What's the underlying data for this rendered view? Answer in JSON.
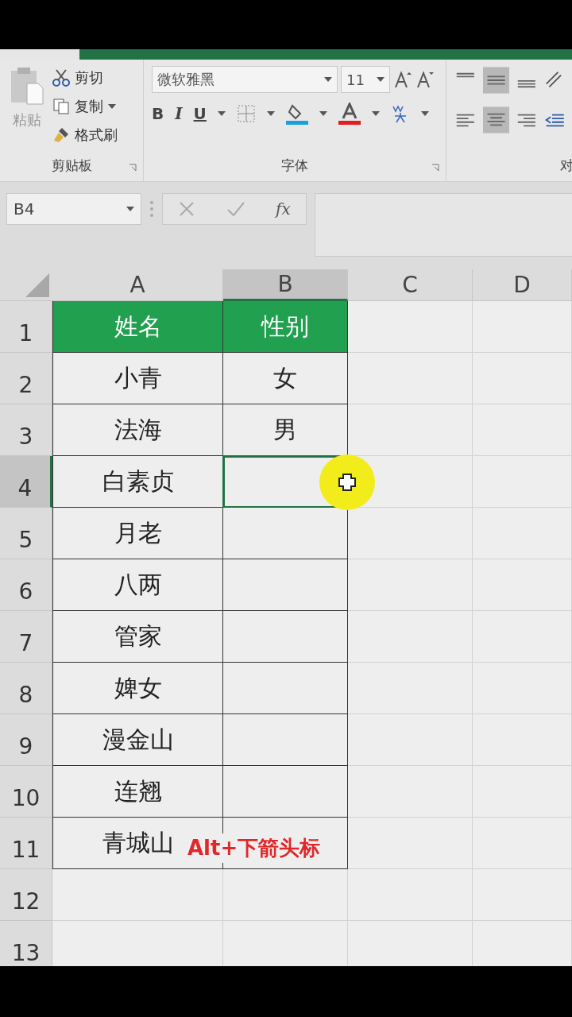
{
  "ribbon": {
    "clipboard": {
      "label": "剪贴板",
      "paste": "粘贴",
      "cut": "剪切",
      "copy": "复制",
      "format_painter": "格式刷"
    },
    "font": {
      "label": "字体",
      "font_name": "微软雅黑",
      "font_size": "11",
      "bold": "B",
      "italic": "I",
      "underline": "U"
    },
    "alignment": {
      "label": "对"
    }
  },
  "formula_bar": {
    "name_box": "B4",
    "fx": "fx"
  },
  "columns": [
    {
      "label": "A",
      "selected": false
    },
    {
      "label": "B",
      "selected": true
    },
    {
      "label": "C",
      "selected": false
    },
    {
      "label": "D",
      "selected": false
    }
  ],
  "rows": [
    {
      "label": "1",
      "kind": "header",
      "selected": false,
      "cells": [
        "姓名",
        "性别"
      ]
    },
    {
      "label": "2",
      "kind": "data",
      "selected": false,
      "cells": [
        "小青",
        "女"
      ]
    },
    {
      "label": "3",
      "kind": "data",
      "selected": false,
      "cells": [
        "法海",
        "男"
      ]
    },
    {
      "label": "4",
      "kind": "data",
      "selected": true,
      "cells": [
        "白素贞"
      ]
    },
    {
      "label": "5",
      "kind": "data",
      "selected": false,
      "cells": [
        "月老"
      ]
    },
    {
      "label": "6",
      "kind": "data",
      "selected": false,
      "cells": [
        "八两"
      ]
    },
    {
      "label": "7",
      "kind": "data",
      "selected": false,
      "cells": [
        "管家"
      ]
    },
    {
      "label": "8",
      "kind": "data",
      "selected": false,
      "cells": [
        "婢女"
      ]
    },
    {
      "label": "9",
      "kind": "data",
      "selected": false,
      "cells": [
        "漫金山"
      ]
    },
    {
      "label": "10",
      "kind": "data",
      "selected": false,
      "cells": [
        "连翘"
      ]
    },
    {
      "label": "11",
      "kind": "data",
      "selected": false,
      "cells": [
        "青城山"
      ]
    },
    {
      "label": "12",
      "kind": "empty",
      "selected": false,
      "cells": []
    },
    {
      "label": "13",
      "kind": "empty",
      "selected": false,
      "cells": []
    }
  ],
  "caption": "Alt+下箭头标"
}
